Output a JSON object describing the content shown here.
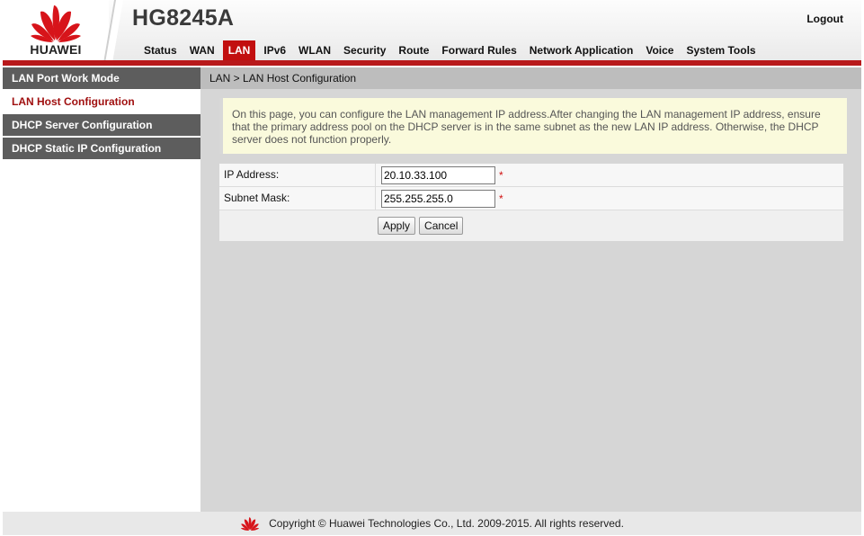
{
  "header": {
    "brand": "HUAWEI",
    "model": "HG8245A",
    "logout_label": "Logout",
    "nav": [
      {
        "label": "Status"
      },
      {
        "label": "WAN"
      },
      {
        "label": "LAN",
        "active": true
      },
      {
        "label": "IPv6"
      },
      {
        "label": "WLAN"
      },
      {
        "label": "Security"
      },
      {
        "label": "Route"
      },
      {
        "label": "Forward Rules"
      },
      {
        "label": "Network Application"
      },
      {
        "label": "Voice"
      },
      {
        "label": "System Tools"
      }
    ]
  },
  "sidebar": {
    "items": [
      {
        "label": "LAN Port Work Mode"
      },
      {
        "label": "LAN Host Configuration",
        "active": true
      },
      {
        "label": "DHCP Server Configuration"
      },
      {
        "label": "DHCP Static IP Configuration"
      }
    ]
  },
  "main": {
    "breadcrumb": "LAN > LAN Host Configuration",
    "notice": "On this page, you can configure the LAN management IP address.After changing the LAN management IP address, ensure that the primary address pool on the DHCP server is in the same subnet as the new LAN IP address. Otherwise, the DHCP server does not function properly.",
    "fields": {
      "ip_label": "IP Address:",
      "ip_value": "20.10.33.100",
      "mask_label": "Subnet Mask:",
      "mask_value": "255.255.255.0",
      "required_mark": "*"
    },
    "buttons": {
      "apply": "Apply",
      "cancel": "Cancel"
    }
  },
  "footer": {
    "copyright": "Copyright © Huawei Technologies Co., Ltd. 2009-2015. All rights reserved."
  },
  "colors": {
    "brand_red": "#c20f0f",
    "sidebar_bg": "#5d5d5d",
    "content_bg": "#d6d6d6",
    "notice_bg": "#fafadc"
  },
  "icons": {
    "logo": "huawei-petal-logo"
  }
}
